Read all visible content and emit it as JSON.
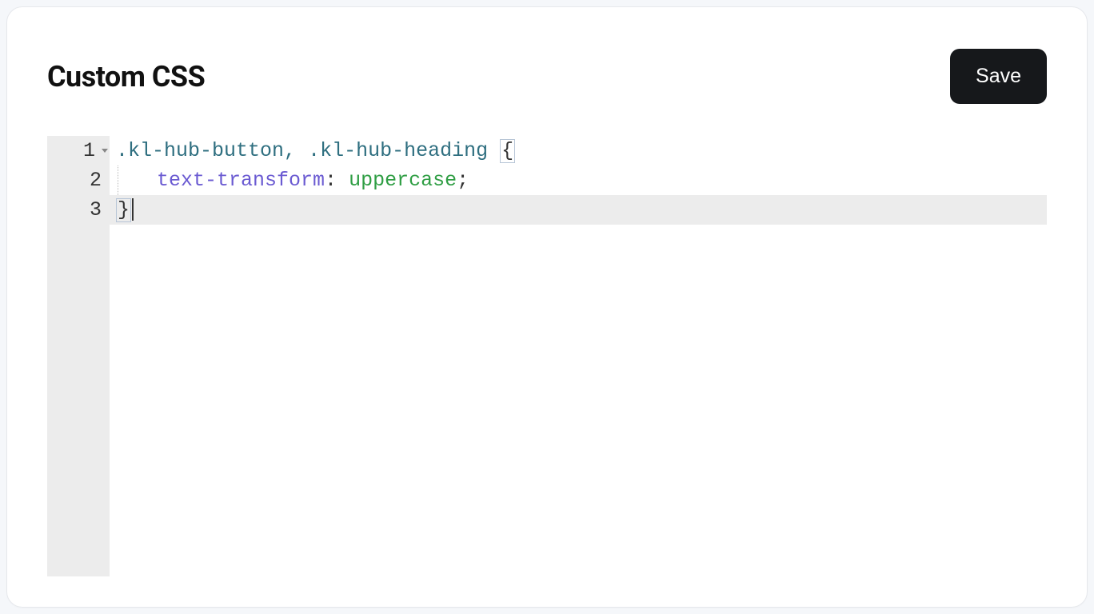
{
  "header": {
    "title": "Custom CSS",
    "save_label": "Save"
  },
  "editor": {
    "line_numbers": [
      "1",
      "2",
      "3"
    ],
    "active_line_index": 2,
    "foldable_lines": [
      0
    ],
    "code": {
      "line1": {
        "selector1": ".kl-hub-button",
        "comma_space": ", ",
        "selector2": ".kl-hub-heading",
        "space": " ",
        "open_brace": "{"
      },
      "line2": {
        "property": "text-transform",
        "colon_space": ": ",
        "value": "uppercase",
        "semicolon": ";"
      },
      "line3": {
        "close_brace": "}"
      }
    },
    "raw": ".kl-hub-button, .kl-hub-heading {\n    text-transform: uppercase;\n}"
  }
}
